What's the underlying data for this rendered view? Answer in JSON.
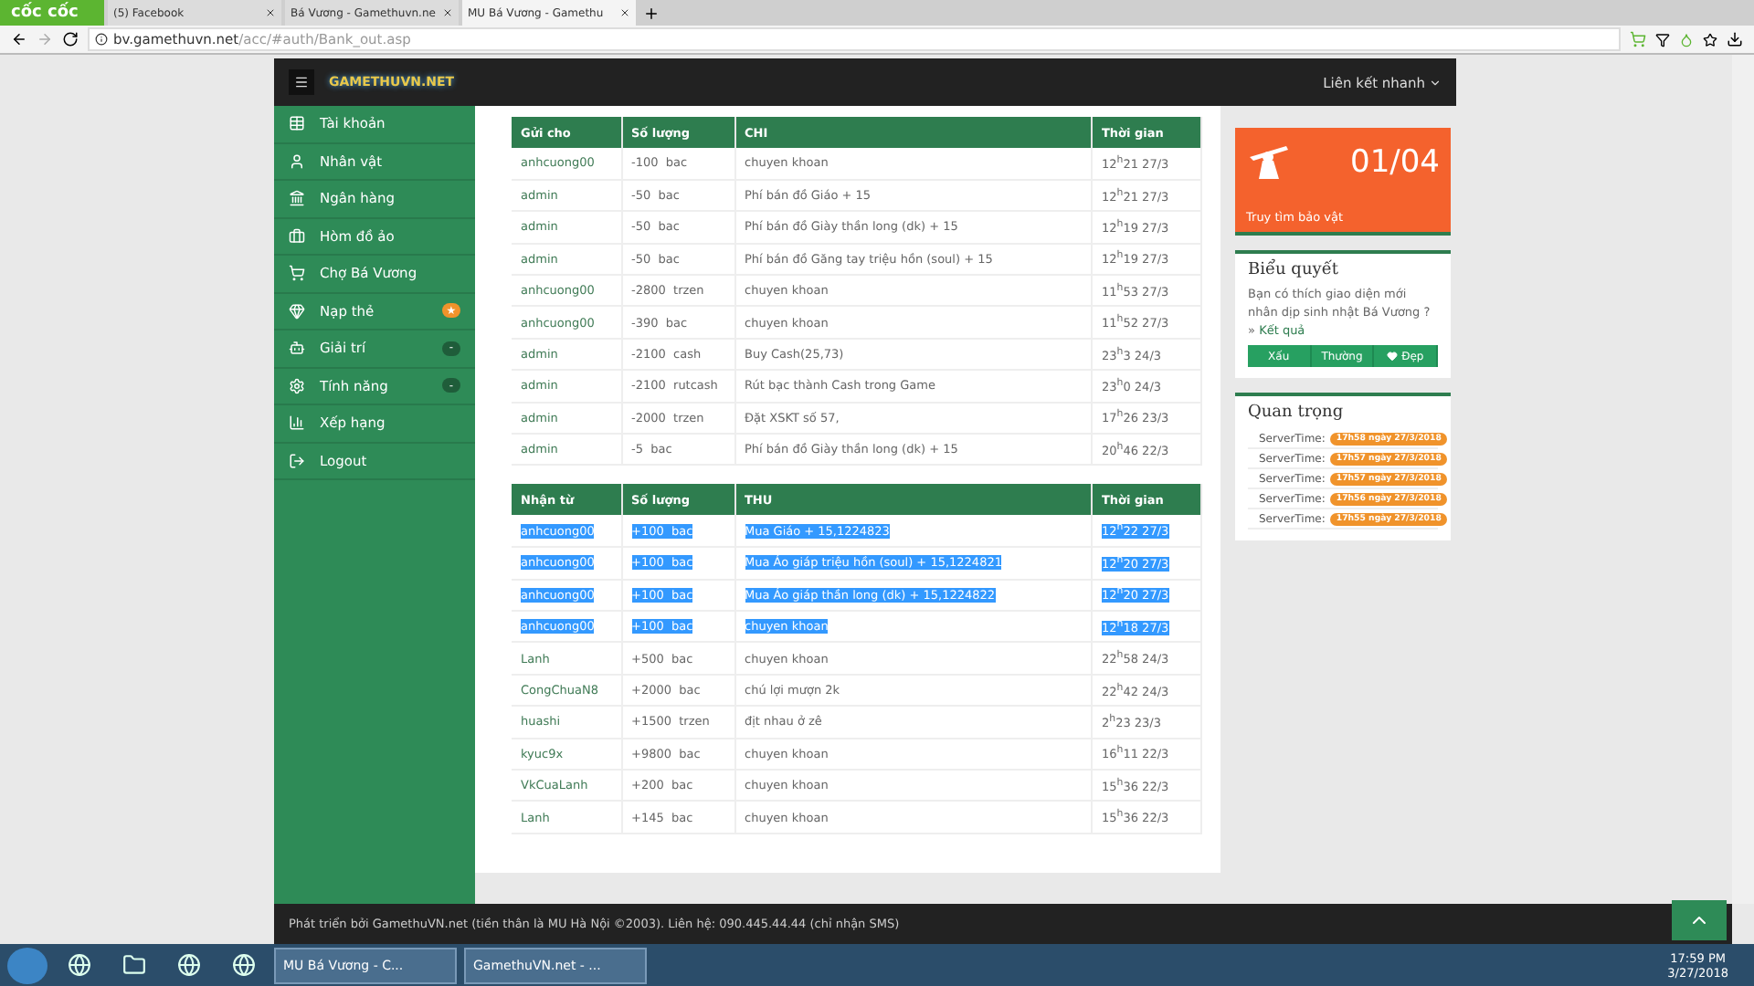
{
  "browser": {
    "brand": "cốc cốc",
    "tabs": [
      {
        "title": "(5) Facebook",
        "selected": false
      },
      {
        "title": "Bá Vương - Gamethuvn.ne",
        "selected": false
      },
      {
        "title": "MU Bá Vương - Gamethu",
        "selected": true
      }
    ],
    "url_host": "bv.gamethuvn.net",
    "url_path": "/acc/#auth/Bank_out.asp"
  },
  "navbar": {
    "logo": "GAMETHUVN.NET",
    "quick_links": "Liên kết nhanh"
  },
  "sidebar": {
    "items": [
      {
        "label": "Tài khoản"
      },
      {
        "label": "Nhân vật"
      },
      {
        "label": "Ngân hàng"
      },
      {
        "label": "Hòm đồ ảo"
      },
      {
        "label": "Chợ Bá Vương"
      },
      {
        "label": "Nạp thẻ",
        "badge": "★",
        "color": "#f0932b"
      },
      {
        "label": "Giải trí",
        "badge": "-",
        "color": "#1f5d3a"
      },
      {
        "label": "Tính năng",
        "badge": "-",
        "color": "#1f5d3a"
      },
      {
        "label": "Xếp hạng"
      },
      {
        "label": "Logout"
      }
    ]
  },
  "spent_table": {
    "columns": [
      "Gửi cho",
      "Số lượng",
      "CHI",
      "Thời gian"
    ],
    "rows": [
      {
        "highlighted": false,
        "cells": [
          "anhcuong00",
          "-100  bac",
          "chuyen khoan",
          "12$^{h}$21 27/3"
        ]
      },
      {
        "highlighted": false,
        "cells": [
          "admin",
          "-50  bac",
          "Phí bán đồ Giáo + 15",
          "12$^{h}$21 27/3"
        ]
      },
      {
        "highlighted": false,
        "cells": [
          "admin",
          "-50  bac",
          "Phí bán đồ Giày thần long (dk) + 15",
          "12$^{h}$19 27/3"
        ]
      },
      {
        "highlighted": false,
        "cells": [
          "admin",
          "-50  bac",
          "Phí bán đồ Găng tay triệu hồn (soul) + 15",
          "12$^{h}$19 27/3"
        ]
      },
      {
        "highlighted": false,
        "cells": [
          "anhcuong00",
          "-2800  trzen",
          "chuyen khoan",
          "11$^{h}$53 27/3"
        ]
      },
      {
        "highlighted": false,
        "cells": [
          "anhcuong00",
          "-390  bac",
          "chuyen khoan",
          "11$^{h}$52 27/3"
        ]
      },
      {
        "highlighted": false,
        "cells": [
          "admin",
          "-2100  cash",
          "Buy Cash(25,73)",
          "23$^{h}$3 24/3"
        ]
      },
      {
        "highlighted": false,
        "cells": [
          "admin",
          "-2100  rutcash",
          "Rút bạc thành Cash trong Game",
          "23$^{h}$0 24/3"
        ]
      },
      {
        "highlighted": false,
        "cells": [
          "admin",
          "-2000  trzen",
          "Đặt XSKT số 57,",
          "17$^{h}$26 23/3"
        ]
      },
      {
        "highlighted": false,
        "cells": [
          "admin",
          "-5  bac",
          "Phí bán đồ Giày thần long (dk) + 15",
          "20$^{h}$46 22/3"
        ]
      }
    ]
  },
  "received_table": {
    "columns": [
      "Nhận từ",
      "Số lượng",
      "THU",
      "Thời gian"
    ],
    "rows": [
      {
        "highlighted": true,
        "cells": [
          "anhcuong00",
          "+100  bac",
          "Mua Giáo + 15,1224823",
          "12$^{h}$22 27/3"
        ]
      },
      {
        "highlighted": true,
        "cells": [
          "anhcuong00",
          "+100  bac",
          "Mua Áo giáp triệu hồn (soul) + 15,1224821",
          "12$^{h}$20 27/3"
        ]
      },
      {
        "highlighted": true,
        "cells": [
          "anhcuong00",
          "+100  bac",
          "Mua Áo giáp thần long (dk) + 15,1224822",
          "12$^{h}$20 27/3"
        ]
      },
      {
        "highlighted": true,
        "cells": [
          "anhcuong00",
          "+100  bac",
          "chuyen khoan",
          "12$^{h}$18 27/3"
        ]
      },
      {
        "highlighted": false,
        "cells": [
          "Lanh",
          "+500  bac",
          "chuyen khoan",
          "22$^{h}$58 24/3"
        ]
      },
      {
        "highlighted": false,
        "cells": [
          "CongChuaN8",
          "+2000  bac",
          "chú lợi mượn 2k",
          "22$^{h}$42 24/3"
        ]
      },
      {
        "highlighted": false,
        "cells": [
          "huashi",
          "+1500  trzen",
          "địt nhau ở zê",
          "2$^{h}$23 23/3"
        ]
      },
      {
        "highlighted": false,
        "cells": [
          "kyuc9x",
          "+9800  bac",
          "chuyen khoan",
          "16$^{h}$11 22/3"
        ]
      },
      {
        "highlighted": false,
        "cells": [
          "VkCuaLanh",
          "+200  bac",
          "chuyen khoan",
          "15$^{h}$36 22/3"
        ]
      },
      {
        "highlighted": false,
        "cells": [
          "Lanh",
          "+145  bac",
          "chuyen khoan",
          "15$^{h}$36 22/3"
        ]
      }
    ]
  },
  "treasure": {
    "count": "01/04",
    "label": "Truy tìm bảo vật"
  },
  "poll": {
    "title": "Biểu quyết",
    "question": "Bạn có thích giao diện mới nhân dịp sinh nhật Bá Vương ? »",
    "result_link": "Kết quả",
    "options": [
      "Xấu",
      "Thường",
      "Đẹp"
    ]
  },
  "important": {
    "title": "Quan trọng",
    "items": [
      {
        "label": "ServerTime:",
        "time": "17h58 ngày 27/3/2018"
      },
      {
        "label": "ServerTime:",
        "time": "17h57 ngày 27/3/2018"
      },
      {
        "label": "ServerTime:",
        "time": "17h57 ngày 27/3/2018"
      },
      {
        "label": "ServerTime:",
        "time": "17h56 ngày 27/3/2018"
      },
      {
        "label": "ServerTime:",
        "time": "17h55 ngày 27/3/2018"
      }
    ]
  },
  "footer": "Phát triển bởi GamethuVN.net (tiền thân là MU Hà Nội ©2003). Liên hệ: 090.445.44.44 (chỉ nhận SMS)",
  "taskbar": {
    "windows": [
      "MU Bá Vương - C...",
      "GamethuVN.net - ..."
    ],
    "time": "17:59 PM",
    "date": "3/27/2018"
  }
}
